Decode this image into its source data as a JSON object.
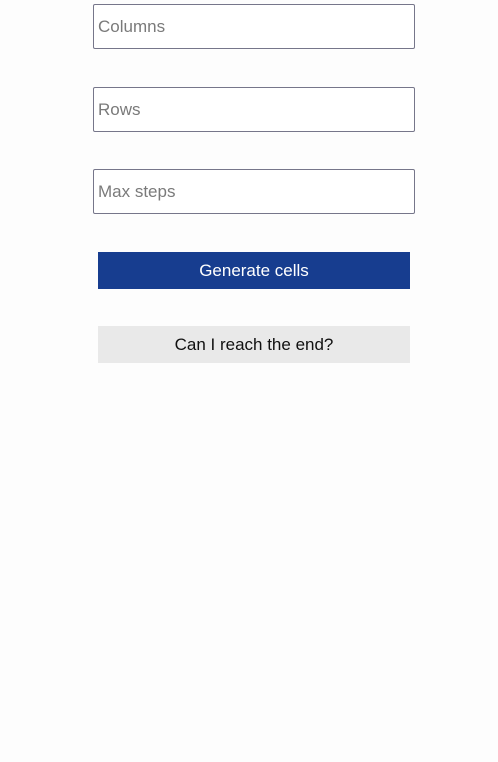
{
  "form": {
    "columns": {
      "placeholder": "Columns",
      "value": ""
    },
    "rows": {
      "placeholder": "Rows",
      "value": ""
    },
    "max_steps": {
      "placeholder": "Max steps",
      "value": ""
    }
  },
  "actions": {
    "generate_label": "Generate cells",
    "check_label": "Can I reach the end?"
  },
  "colors": {
    "primary_button": "#173d8f",
    "secondary_button": "#e9e9e9",
    "input_border": "#76768a",
    "background": "#fdfdfd"
  }
}
